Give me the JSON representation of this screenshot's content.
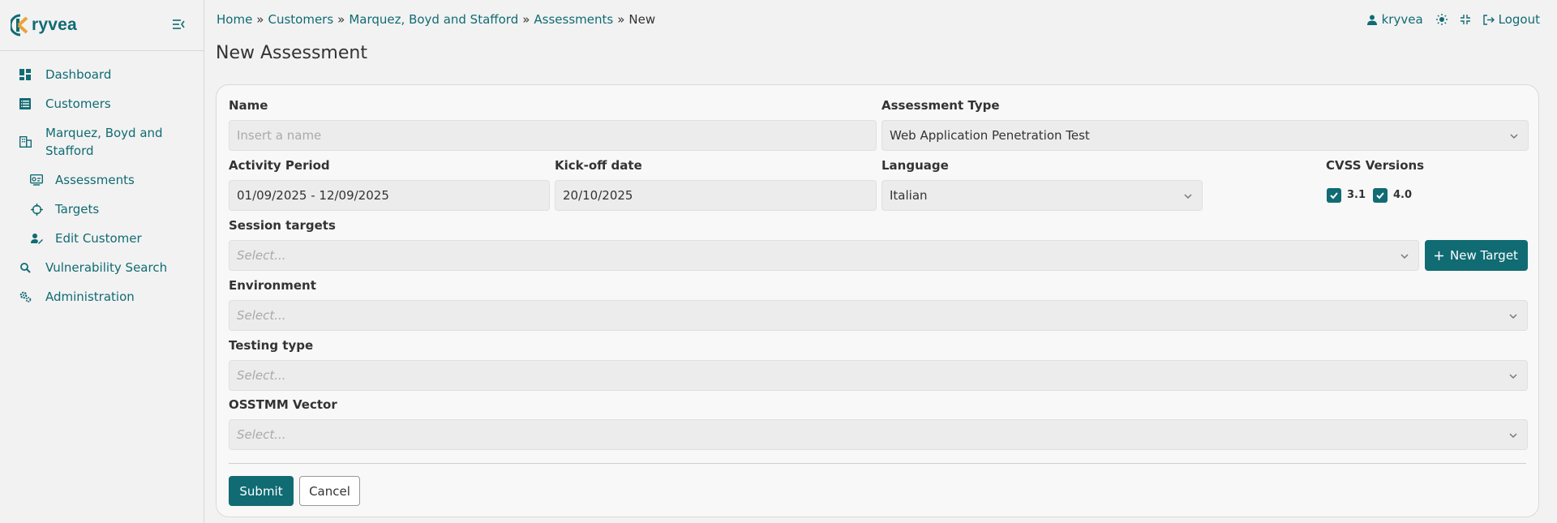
{
  "app": {
    "logo_text": "ryvea"
  },
  "sidebar": {
    "items": [
      {
        "label": "Dashboard",
        "icon": "dashboard-icon"
      },
      {
        "label": "Customers",
        "icon": "table-icon"
      },
      {
        "label_line1": "Marquez, Boyd and",
        "label_line2": "Stafford",
        "icon": "building-icon"
      },
      {
        "label": "Assessments",
        "icon": "assessment-icon"
      },
      {
        "label": "Targets",
        "icon": "crosshair-icon"
      },
      {
        "label": "Edit Customer",
        "icon": "user-edit-icon"
      },
      {
        "label": "Vulnerability Search",
        "icon": "search-icon"
      },
      {
        "label": "Administration",
        "icon": "gears-icon"
      }
    ]
  },
  "breadcrumb": {
    "home": "Home",
    "sep": "»",
    "customers": "Customers",
    "customer": "Marquez, Boyd and Stafford",
    "assessments": "Assessments",
    "current": "New"
  },
  "topbar": {
    "user": "kryvea",
    "logout": "Logout"
  },
  "page": {
    "title": "New Assessment"
  },
  "form": {
    "name_label": "Name",
    "name_placeholder": "Insert a name",
    "assessment_type_label": "Assessment Type",
    "assessment_type_value": "Web Application Penetration Test",
    "activity_period_label": "Activity Period",
    "activity_period_value": "01/09/2025 - 12/09/2025",
    "kickoff_label": "Kick-off date",
    "kickoff_value": "20/10/2025",
    "language_label": "Language",
    "language_value": "Italian",
    "cvss_label": "CVSS Versions",
    "cvss_options": [
      {
        "label": "3.1",
        "checked": true
      },
      {
        "label": "4.0",
        "checked": true
      }
    ],
    "session_targets_label": "Session targets",
    "select_placeholder": "Select...",
    "new_target_label": "New Target",
    "environment_label": "Environment",
    "testing_type_label": "Testing type",
    "osstmm_label": "OSSTMM Vector",
    "submit_label": "Submit",
    "cancel_label": "Cancel"
  },
  "colors": {
    "accent": "#106b73",
    "background": "#f2f2f2"
  }
}
